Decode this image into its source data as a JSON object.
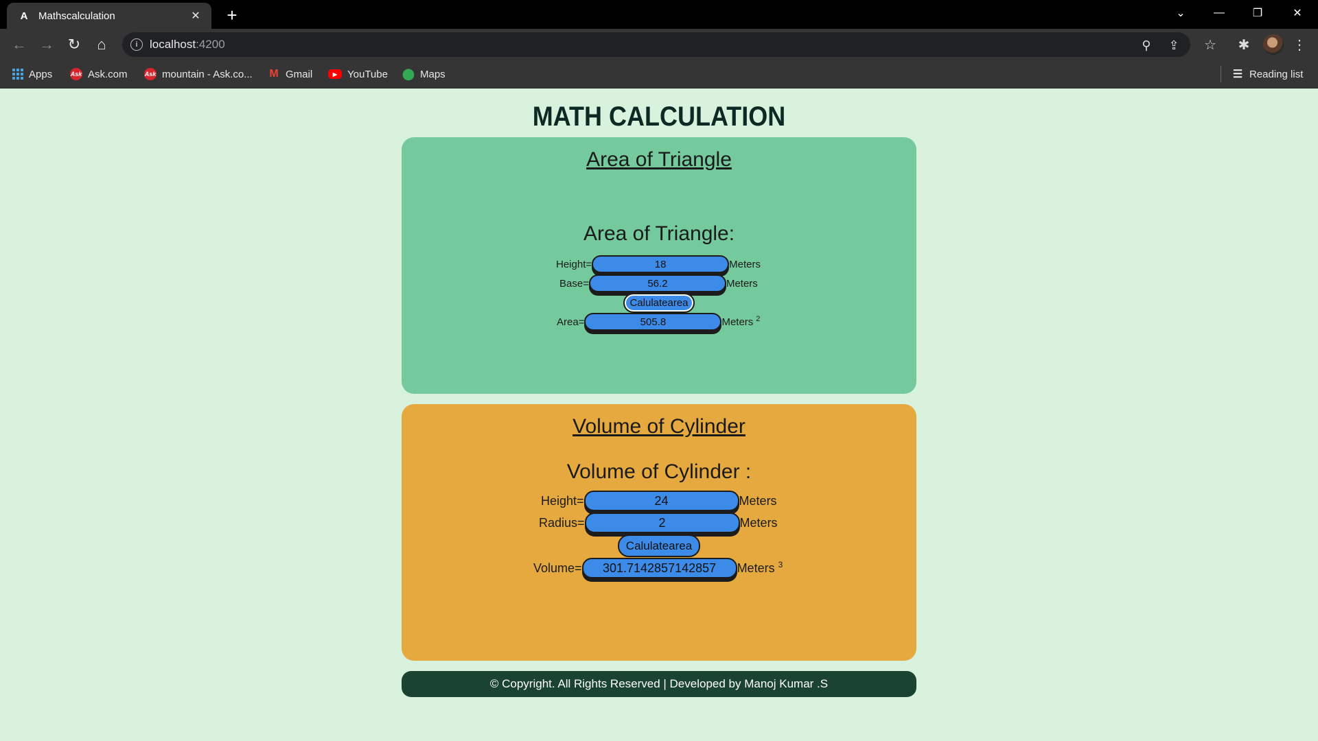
{
  "browser": {
    "tab_title": "Mathscalculation",
    "url_host": "localhost",
    "url_port": ":4200",
    "bookmarks": [
      "Apps",
      "Ask.com",
      "mountain - Ask.co...",
      "Gmail",
      "YouTube",
      "Maps"
    ],
    "reading_list": "Reading list"
  },
  "page": {
    "title": "MATH CALCULATION"
  },
  "triangle": {
    "heading": "Area of Triangle",
    "subheading": "Area of Triangle:",
    "height_label": "Height=",
    "height_value": "18",
    "base_label": "Base=",
    "base_value": "56.2",
    "unit": "Meters",
    "button_label": "Calulatearea",
    "area_label": "Area=",
    "area_value": "505.8",
    "area_exp": "2"
  },
  "cylinder": {
    "heading": "Volume of Cylinder",
    "subheading": "Volume of Cylinder :",
    "height_label": "Height=",
    "height_value": "24",
    "radius_label": "Radius=",
    "radius_value": "2",
    "unit": "Meters",
    "button_label": "Calulatearea",
    "volume_label": "Volume=",
    "volume_value": "301.7142857142857",
    "volume_exp": "3"
  },
  "footer": {
    "text": "© Copyright. All Rights Reserved | Developed by Manoj Kumar .S"
  }
}
